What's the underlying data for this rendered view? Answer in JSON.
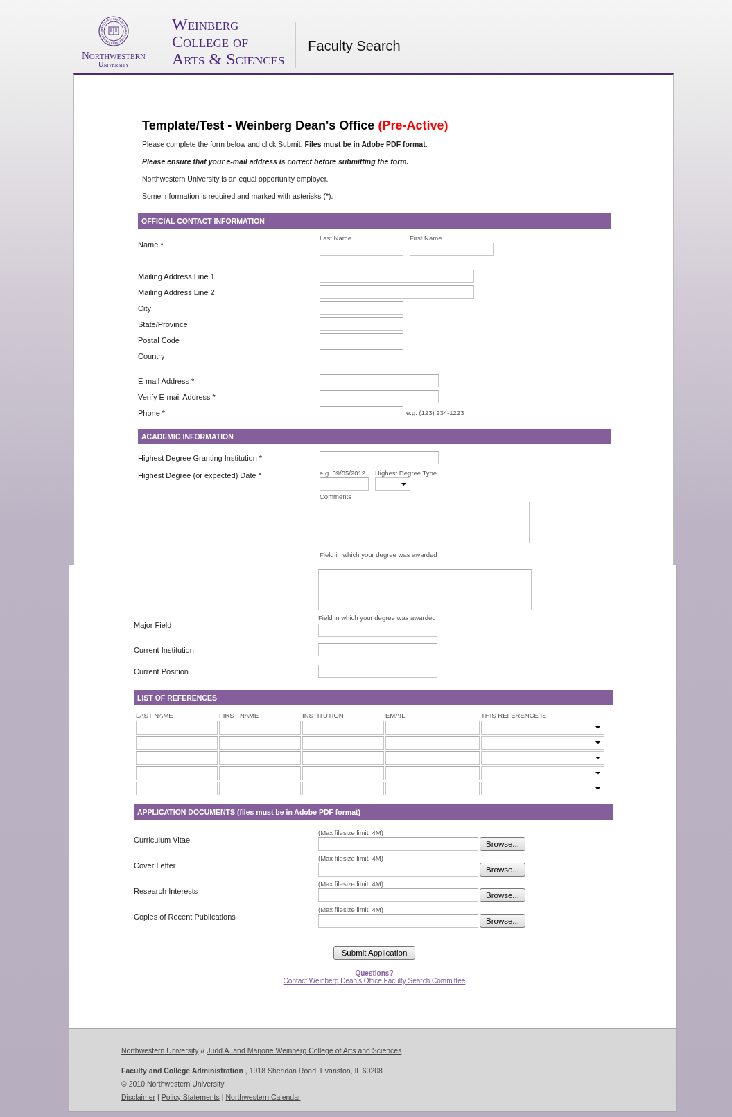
{
  "header": {
    "university": "Northwestern",
    "university_sub": "University",
    "college": [
      "Weinberg",
      "College of",
      "Arts & Sciences"
    ],
    "site_title": "Faculty Search"
  },
  "panels": [
    {
      "title": "Template/Test - Weinberg Dean's Office",
      "status": "(Pre-Active)",
      "intro": [
        {
          "kind": "plain",
          "text": "Please complete the form below and click Submit. **Files must be in Adobe PDF format**."
        },
        {
          "kind": "emphasis",
          "text": "Please ensure that your e-mail address is correct before submitting the form."
        },
        {
          "kind": "plain",
          "text": "Northwestern University is an equal opportunity employer."
        },
        {
          "kind": "plain",
          "text": "Some information is required and marked with asterisks (*)."
        }
      ],
      "blocks": [
        {
          "kind": "bar",
          "text": "OFFICIAL CONTACT INFORMATION"
        },
        {
          "kind": "name",
          "label": "Name *",
          "sublabels": [
            "Last Name",
            "First Name"
          ]
        },
        {
          "kind": "fields",
          "rows": [
            {
              "label": "Mailing Address Line 1",
              "kind": "long"
            },
            {
              "label": "Mailing Address Line 2",
              "kind": "long"
            },
            {
              "label": "City",
              "kind": "short"
            },
            {
              "label": "State/Province",
              "kind": "short"
            },
            {
              "label": "Postal Code",
              "kind": "short"
            },
            {
              "label": "Country",
              "kind": "short"
            }
          ]
        },
        {
          "kind": "fields",
          "rows": [
            {
              "label": "E-mail Address *",
              "kind": "medium"
            },
            {
              "label": "Verify E-mail Address *",
              "kind": "medium"
            },
            {
              "label": "Phone *",
              "kind": "short",
              "hint": "e.g. (123) 234-1223"
            }
          ]
        },
        {
          "kind": "bar",
          "text": "ACADEMIC INFORMATION"
        },
        {
          "kind": "fields",
          "rows": [
            {
              "label": "Highest Degree Granting Institution *",
              "kind": "medium"
            }
          ]
        },
        {
          "kind": "date",
          "label": "Highest Degree (or expected) Date *",
          "date_hint": "e.g. 09/05/2012",
          "type_label": "Highest Degree Type",
          "comments_label": "Comments",
          "caption": "Field in which your degree was awarded"
        }
      ]
    },
    {
      "blocks": [
        {
          "kind": "textarea"
        },
        {
          "kind": "captioned",
          "label": "Major Field",
          "caption": "Field in which your degree was awarded"
        },
        {
          "kind": "wide-fields",
          "rows": [
            {
              "label": "Current Institution",
              "kind": "medium"
            },
            {
              "label": "Current Position",
              "kind": "medium"
            }
          ]
        },
        {
          "kind": "bar",
          "text": "LIST OF REFERENCES"
        },
        {
          "kind": "references",
          "columns": [
            "LAST NAME",
            "FIRST NAME",
            "INSTITUTION",
            "EMAIL",
            "THIS REFERENCE IS"
          ],
          "rows": [
            {
              "kind": "entry"
            },
            {
              "kind": "entry"
            },
            {
              "kind": "entry"
            },
            {
              "kind": "entry"
            },
            {
              "kind": "entry"
            }
          ]
        },
        {
          "kind": "bar",
          "text": "APPLICATION DOCUMENTS (files must be in Adobe PDF format)"
        },
        {
          "kind": "files",
          "rows": [
            {
              "label": "Curriculum Vitae",
              "note": "(Max filesize limit: 4M)",
              "button": "Browse..."
            },
            {
              "label": "Cover Letter",
              "note": "(Max filesize limit: 4M)",
              "button": "Browse..."
            },
            {
              "label": "Research Interests",
              "note": "(Max filesize limit: 4M)",
              "button": "Browse..."
            },
            {
              "label": "Copies of Recent Publications",
              "note": "(Max filesize limit: 4M)",
              "button": "Browse..."
            }
          ]
        }
      ],
      "submit": "Submit Application",
      "questions": "Questions?",
      "contact_link": "Contact Weinberg Dean's Office Faculty Search Committee"
    }
  ],
  "footer": {
    "top": [
      {
        "kind": "link",
        "text": "Northwestern University"
      },
      {
        "kind": "sep",
        "text": "//"
      },
      {
        "kind": "link",
        "text": "Judd A. and Marjorie Weinberg College of Arts and Sciences"
      }
    ],
    "address": "**Faculty and College Administration**, 1918 Sheridan Road, Evanston, IL 60208",
    "copyright": "© 2010 Northwestern University",
    "bottom": [
      {
        "kind": "link",
        "text": "Disclaimer"
      },
      {
        "kind": "sep",
        "text": "|"
      },
      {
        "kind": "link",
        "text": "Policy Statements"
      },
      {
        "kind": "sep",
        "text": "|"
      },
      {
        "kind": "link",
        "text": "Northwestern Calendar"
      }
    ]
  }
}
